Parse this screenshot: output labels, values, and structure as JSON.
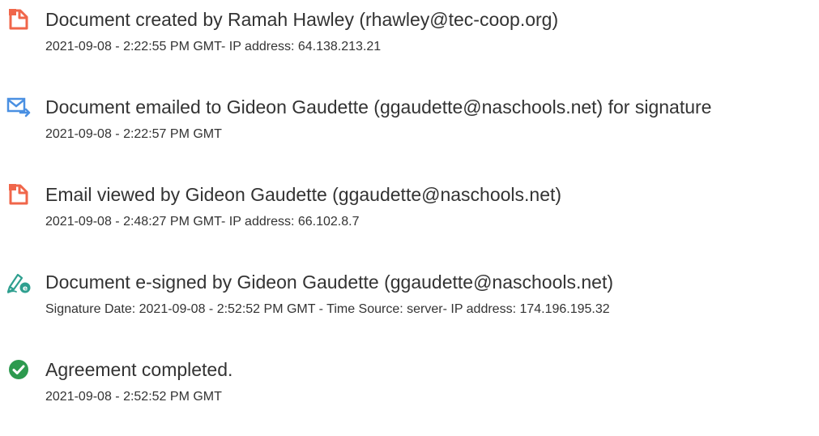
{
  "colors": {
    "doc_icon": "#f0664a",
    "mail_icon": "#4a90e2",
    "sign_icon": "#2e9f8f",
    "check_icon": "#2d9a4f",
    "text": "#333333"
  },
  "events": [
    {
      "icon": "document-icon",
      "title": "Document created by Ramah Hawley (rhawley@tec-coop.org)",
      "detail": "2021-09-08 - 2:22:55 PM GMT- IP address: 64.138.213.21"
    },
    {
      "icon": "email-send-icon",
      "title": "Document emailed to Gideon Gaudette (ggaudette@naschools.net) for signature",
      "detail": "2021-09-08 - 2:22:57 PM GMT"
    },
    {
      "icon": "document-icon",
      "title": "Email viewed by Gideon Gaudette (ggaudette@naschools.net)",
      "detail": "2021-09-08 - 2:48:27 PM GMT- IP address: 66.102.8.7"
    },
    {
      "icon": "e-sign-pen-icon",
      "title": "Document e-signed by Gideon Gaudette (ggaudette@naschools.net)",
      "detail": "Signature Date: 2021-09-08 - 2:52:52 PM GMT - Time Source: server- IP address: 174.196.195.32"
    },
    {
      "icon": "check-circle-icon",
      "title": "Agreement completed.",
      "detail": "2021-09-08 - 2:52:52 PM GMT"
    }
  ]
}
